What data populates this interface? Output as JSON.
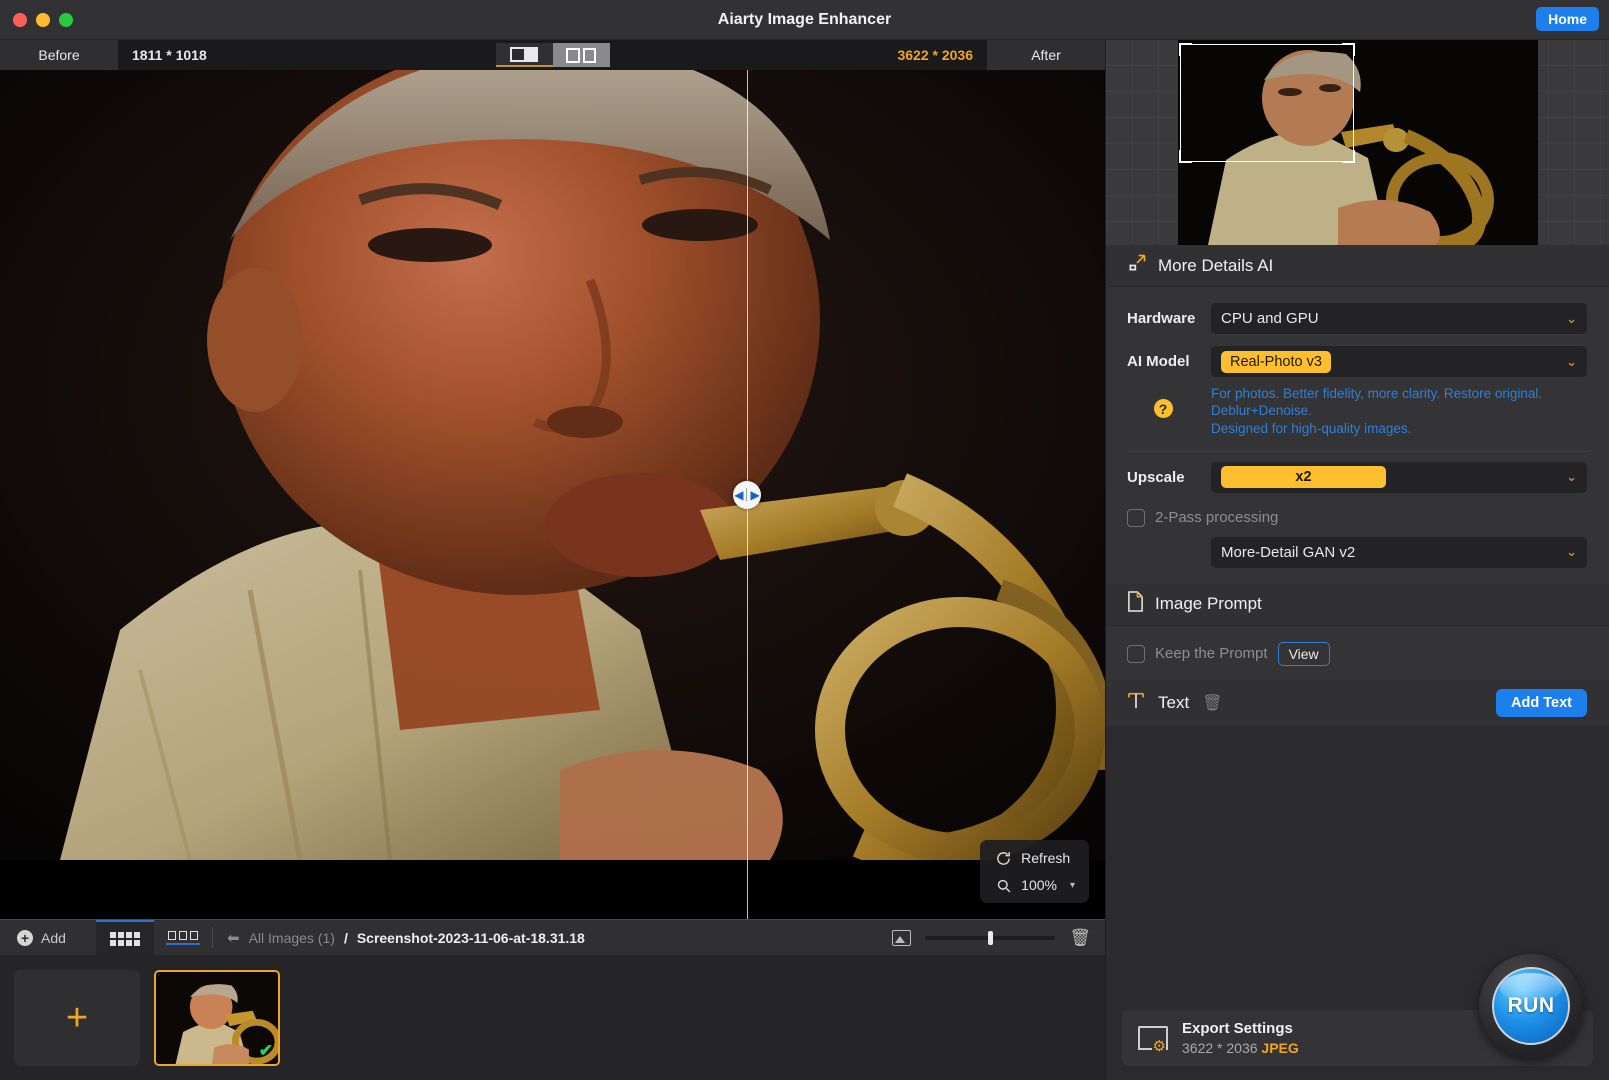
{
  "titlebar": {
    "app_title": "Aiarty Image Enhancer",
    "home_label": "Home",
    "traffic": [
      "close",
      "minimize",
      "zoom"
    ]
  },
  "viewer": {
    "before_label": "Before",
    "before_size": "1811 * 1018",
    "after_label": "After",
    "after_size": "3622 * 2036",
    "view_modes": [
      {
        "name": "split-view",
        "selected": true
      },
      {
        "name": "side-by-side-view",
        "selected": false
      }
    ],
    "overlay": {
      "refresh_label": "Refresh",
      "zoom_label": "100%"
    }
  },
  "bottombar": {
    "add_label": "Add",
    "view_grid": "grid-view",
    "view_row": "row-view",
    "breadcrumb_all": "All Images (1)",
    "breadcrumb_sep": "/",
    "breadcrumb_current": "Screenshot-2023-11-06-at-18.31.18",
    "slider_value": 48
  },
  "filmstrip": {
    "add_label": "+",
    "items": [
      {
        "name": "trumpet-player-thumbnail",
        "selected": true,
        "checked": true
      }
    ]
  },
  "panel": {
    "more_details": {
      "title": "More Details AI",
      "hardware_label": "Hardware",
      "hardware_value": "CPU and GPU",
      "ai_model_label": "AI Model",
      "ai_model_value": "Real-Photo v3",
      "description_line1": "For photos. Better fidelity, more clarity. Restore original.",
      "description_line2": "Deblur+Denoise.",
      "description_line3": "Designed for high-quality images.",
      "upscale_label": "Upscale",
      "upscale_value": "x2",
      "two_pass_label": "2-Pass processing",
      "two_pass_checked": false,
      "two_pass_model": "More-Detail GAN v2"
    },
    "image_prompt": {
      "title": "Image Prompt",
      "keep_prompt_label": "Keep the Prompt",
      "keep_prompt_checked": false,
      "view_label": "View"
    },
    "text": {
      "title": "Text",
      "add_text_label": "Add Text"
    },
    "export": {
      "title": "Export Settings",
      "size": "3622 * 2036",
      "format": "JPEG"
    },
    "run_label": "RUN"
  },
  "colors": {
    "accent_yellow": "#fdbf2d",
    "accent_blue": "#1d7fec",
    "link_blue": "#2f7fd6",
    "panel_bg": "#2b2b2d",
    "check_green": "#1fd65f"
  }
}
